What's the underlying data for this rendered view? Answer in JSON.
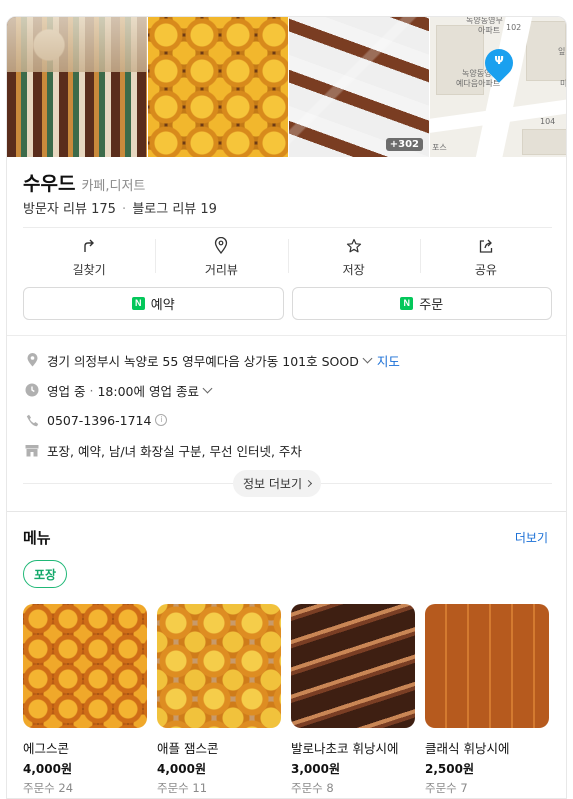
{
  "place": {
    "name": "수우드",
    "category": "카페,디저트",
    "visitor_reviews": "방문자 리뷰 175",
    "blog_reviews": "블로그 리뷰 19",
    "photo_count_badge": "+302"
  },
  "map_thumb": {
    "labels": [
      "녹양동영무",
      "아파트",
      "102",
      "녹양동영",
      "예다음아파트",
      "104",
      "포스",
      "미",
      "잎"
    ]
  },
  "actions": [
    {
      "label": "길찾기",
      "icon": "directions-icon"
    },
    {
      "label": "거리뷰",
      "icon": "location-pin-icon"
    },
    {
      "label": "저장",
      "icon": "star-icon"
    },
    {
      "label": "공유",
      "icon": "share-icon"
    }
  ],
  "buttons": {
    "reserve": "예약",
    "order": "주문"
  },
  "info": {
    "address": "경기 의정부시 녹양로 55 영무예다음 상가동 101호 SOOD",
    "map_link": "지도",
    "status": "영업 중",
    "hours": "18:00에 영업 종료",
    "phone": "0507-1396-1714",
    "amenities": "포장, 예약, 남/녀 화장실 구분, 무선 인터넷, 주차",
    "more_label": "정보 더보기"
  },
  "menu": {
    "title": "메뉴",
    "more": "더보기",
    "filter_tag": "포장",
    "items": [
      {
        "name": "에그스콘",
        "price": "4,000원",
        "orders": "주문수 24"
      },
      {
        "name": "애플 잼스콘",
        "price": "4,000원",
        "orders": "주문수 11"
      },
      {
        "name": "발로나초코 휘낭시에",
        "price": "3,000원",
        "orders": "주문수 8"
      },
      {
        "name": "클래식 휘낭시에",
        "price": "2,500원",
        "orders": "주문수 7"
      }
    ]
  },
  "colors": {
    "link": "#1a6fd6",
    "naver_green": "#03c75a",
    "tag_green": "#13a86a",
    "pin_blue": "#1aa0ef"
  }
}
